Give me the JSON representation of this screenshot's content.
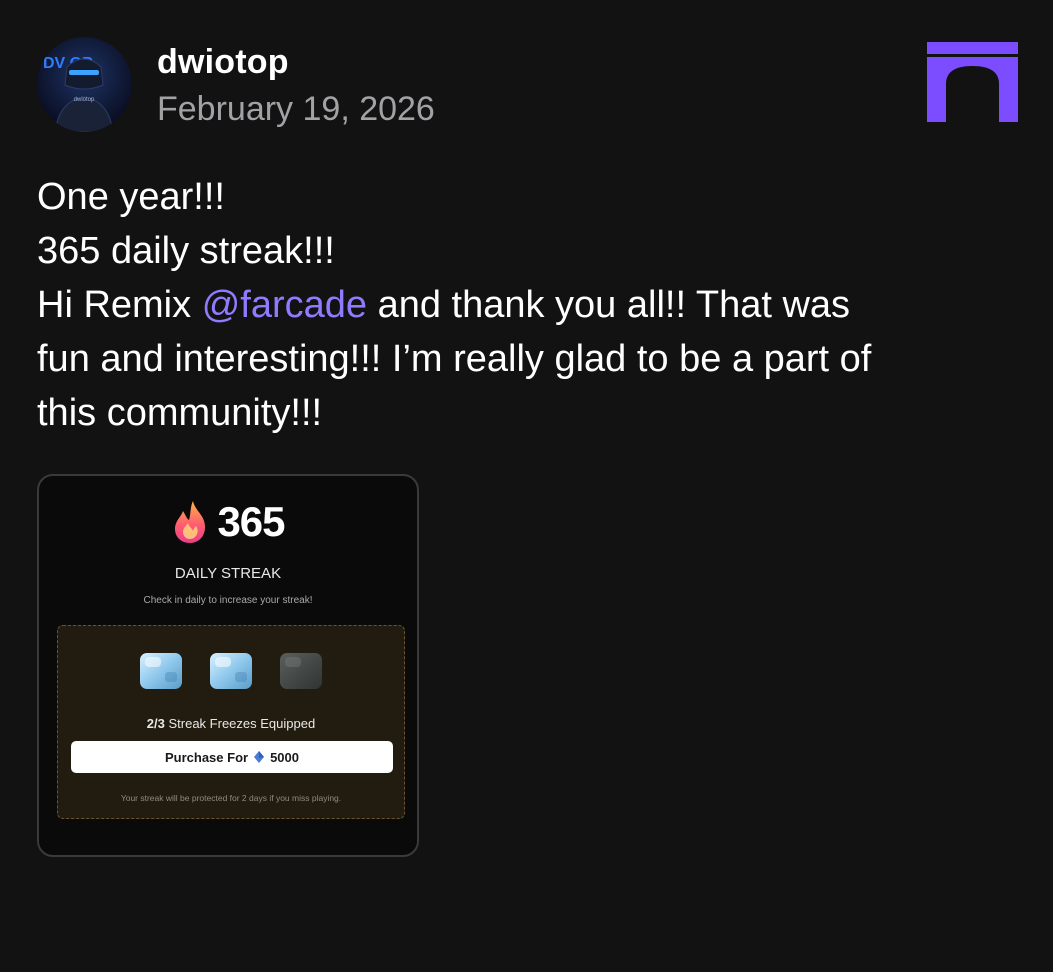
{
  "post": {
    "author": {
      "username": "dwiotop",
      "avatar_text": "DV  OP",
      "avatar_badge": "dwiotop"
    },
    "date": "February 19, 2026",
    "body_lines": {
      "l1": "One year!!!",
      "l2": "365 daily streak!!!",
      "l3_before": "Hi Remix ",
      "mention": "@farcade",
      "l3_after": " and thank you all!! That was",
      "l4": "fun and interesting!!! I’m really glad to be a part of",
      "l5": "this community!!!"
    },
    "brand_logo_icon": "arch-logo-icon",
    "colors": {
      "background": "#121212",
      "mention": "#8f7bff",
      "brand": "#7b4dff",
      "date": "#a2a2a6"
    }
  },
  "attachment": {
    "streak_count": "365",
    "title": "DAILY STREAK",
    "subtitle": "Check in daily to increase your streak!",
    "freezes_equipped": "2/3",
    "freezes_label": " Streak Freezes Equipped",
    "freezes": [
      {
        "state": "equipped"
      },
      {
        "state": "equipped"
      },
      {
        "state": "empty"
      }
    ],
    "purchase_label": "Purchase For",
    "purchase_price": "5000",
    "purchase_currency_icon": "diamond-icon",
    "protect_note": "Your streak will be protected for 2 days if you miss playing."
  }
}
